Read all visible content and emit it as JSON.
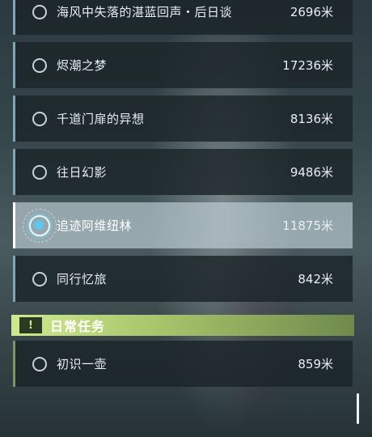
{
  "quests": [
    {
      "title": "海风中失落的湛蓝回声・后日谈",
      "distance": "2696米"
    },
    {
      "title": "烬潮之梦",
      "distance": "17236米"
    },
    {
      "title": "千道门扉的异想",
      "distance": "8136米"
    },
    {
      "title": "往日幻影",
      "distance": "9486米"
    },
    {
      "title": "追迹阿维纽林",
      "distance": "11875米"
    },
    {
      "title": "同行忆旅",
      "distance": "842米"
    }
  ],
  "daily_section": {
    "title": "日常任务",
    "icon": "exclamation-icon",
    "color": "#b6d36e"
  },
  "daily_quests": [
    {
      "title": "初识一壶",
      "distance": "859米"
    }
  ],
  "colors": {
    "accent_blue": "#7fa6b8",
    "selected_bg": "#c6d6de",
    "daily_green": "#b6d36e"
  }
}
